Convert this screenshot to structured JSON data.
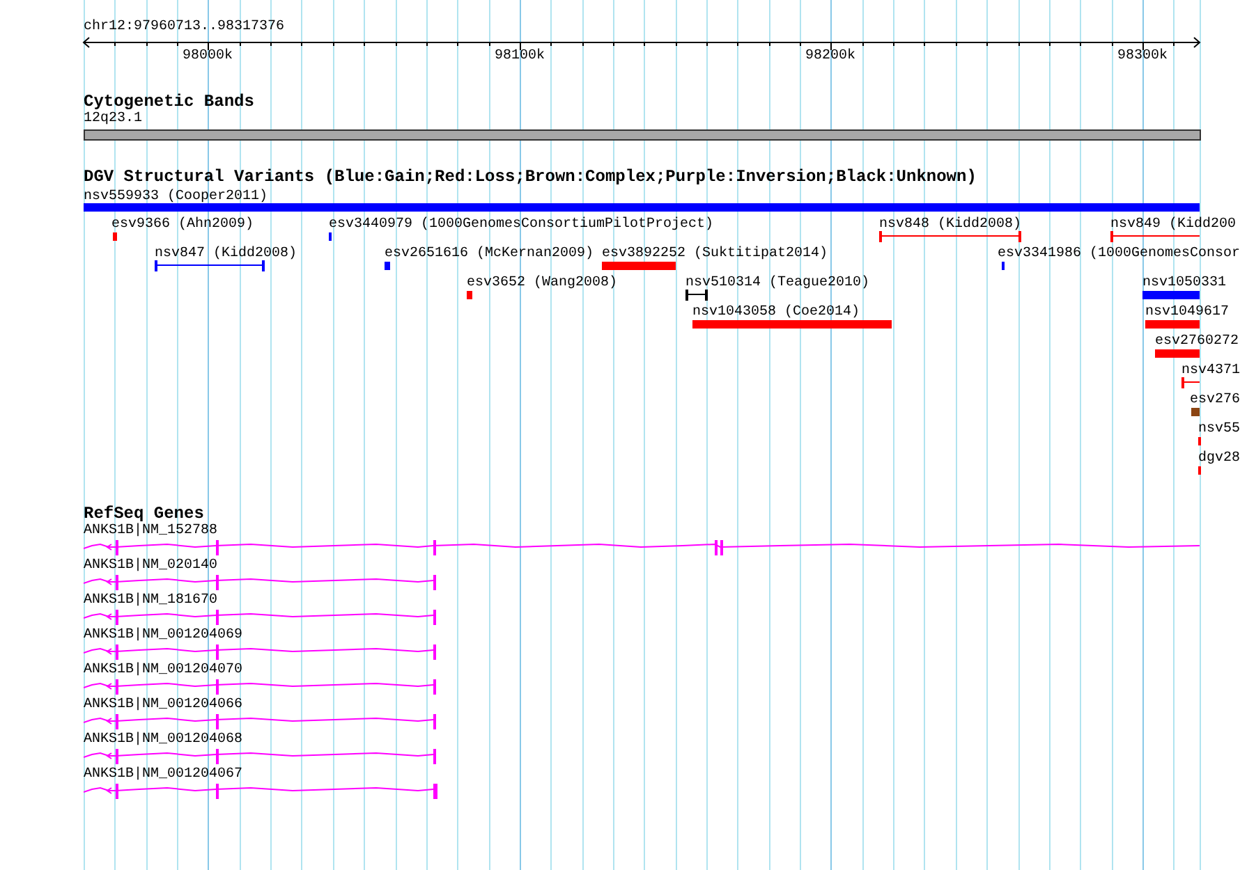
{
  "ruler": {
    "location": "chr12:97960713..98317376",
    "ticks": [
      "98000k",
      "98100k",
      "98200k",
      "98300k"
    ]
  },
  "cytobands": {
    "title": "Cytogenetic Bands",
    "band": "12q23.1"
  },
  "dgv": {
    "title": "DGV Structural Variants (Blue:Gain;Red:Loss;Brown:Complex;Purple:Inversion;Black:Unknown)",
    "features": [
      {
        "label": "nsv559933 (Cooper2011)",
        "kind": "bar",
        "color": "#0000ff"
      },
      {
        "label": "esv9366 (Ahn2009)",
        "kind": "bar",
        "color": "#ff0000"
      },
      {
        "label": "esv3440979 (1000GenomesConsortiumPilotProject)",
        "kind": "bar",
        "color": "#0000ff"
      },
      {
        "label": "nsv848 (Kidd2008)",
        "kind": "span",
        "color": "#ff0000"
      },
      {
        "label": "nsv849 (Kidd200",
        "kind": "span",
        "color": "#ff0000"
      },
      {
        "label": "nsv847 (Kidd2008)",
        "kind": "span",
        "color": "#0000ff"
      },
      {
        "label": "esv2651616 (McKernan2009)",
        "kind": "bar",
        "color": "#0000ff"
      },
      {
        "label": "esv3892252 (Suktitipat2014)",
        "kind": "bar",
        "color": "#ff0000"
      },
      {
        "label": "esv3341986 (1000GenomesConsor",
        "kind": "bar",
        "color": "#0000ff"
      },
      {
        "label": "esv3652 (Wang2008)",
        "kind": "bar",
        "color": "#ff0000"
      },
      {
        "label": "nsv510314 (Teague2010)",
        "kind": "span",
        "color": "#000000"
      },
      {
        "label": "nsv1050331",
        "kind": "bar",
        "color": "#0000ff"
      },
      {
        "label": "nsv1043058 (Coe2014)",
        "kind": "bar",
        "color": "#ff0000"
      },
      {
        "label": "nsv1049617",
        "kind": "bar",
        "color": "#ff0000"
      },
      {
        "label": "esv2760272",
        "kind": "bar",
        "color": "#ff0000"
      },
      {
        "label": "nsv4371",
        "kind": "span",
        "color": "#ff0000"
      },
      {
        "label": "esv276",
        "kind": "bar",
        "color": "#8b4513"
      },
      {
        "label": "nsv55",
        "kind": "bar",
        "color": "#ff0000"
      },
      {
        "label": "dgv28",
        "kind": "bar",
        "color": "#ff0000"
      }
    ]
  },
  "refseq": {
    "title": "RefSeq Genes",
    "genes": [
      {
        "label": "ANKS1B|NM_152788"
      },
      {
        "label": "ANKS1B|NM_020140"
      },
      {
        "label": "ANKS1B|NM_181670"
      },
      {
        "label": "ANKS1B|NM_001204069"
      },
      {
        "label": "ANKS1B|NM_001204070"
      },
      {
        "label": "ANKS1B|NM_001204066"
      },
      {
        "label": "ANKS1B|NM_001204068"
      },
      {
        "label": "ANKS1B|NM_001204067"
      }
    ]
  }
}
